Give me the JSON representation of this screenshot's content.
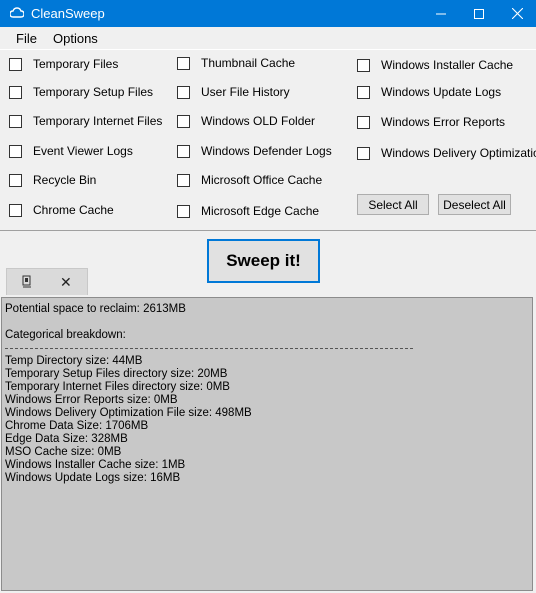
{
  "window": {
    "title": "CleanSweep"
  },
  "menu": {
    "file": "File",
    "options": "Options"
  },
  "checkboxes": {
    "col1": [
      "Temporary Files",
      "Temporary Setup Files",
      "Temporary Internet Files",
      "Event Viewer Logs",
      "Recycle Bin",
      "Chrome Cache"
    ],
    "col2": [
      "Thumbnail Cache",
      "User File History",
      "Windows OLD Folder",
      "Windows Defender Logs",
      "Microsoft Office Cache",
      "Microsoft Edge Cache"
    ],
    "col3": [
      "Windows Installer Cache",
      "Windows Update Logs",
      "Windows Error Reports",
      "Windows Delivery Optimization"
    ]
  },
  "buttons": {
    "select_all": "Select All",
    "deselect_all": "Deselect All",
    "sweep": "Sweep it!"
  },
  "output": {
    "potential": "Potential space to reclaim: 2613MB",
    "breakdown_heading": "Categorical breakdown:",
    "lines": [
      "Temp Directory size: 44MB",
      "Temporary Setup Files directory size: 20MB",
      "Temporary Internet Files directory size: 0MB",
      "Windows Error Reports size: 0MB",
      "Windows Delivery Optimization File size: 498MB",
      "Chrome Data Size: 1706MB",
      "Edge Data Size: 328MB",
      "MSO Cache size: 0MB",
      "Windows Installer Cache size: 1MB",
      "Windows Update Logs size: 16MB"
    ]
  },
  "colors": {
    "titlebar": "#0078d7",
    "accent": "#0078d7",
    "output_bg": "#c8c8c8"
  }
}
